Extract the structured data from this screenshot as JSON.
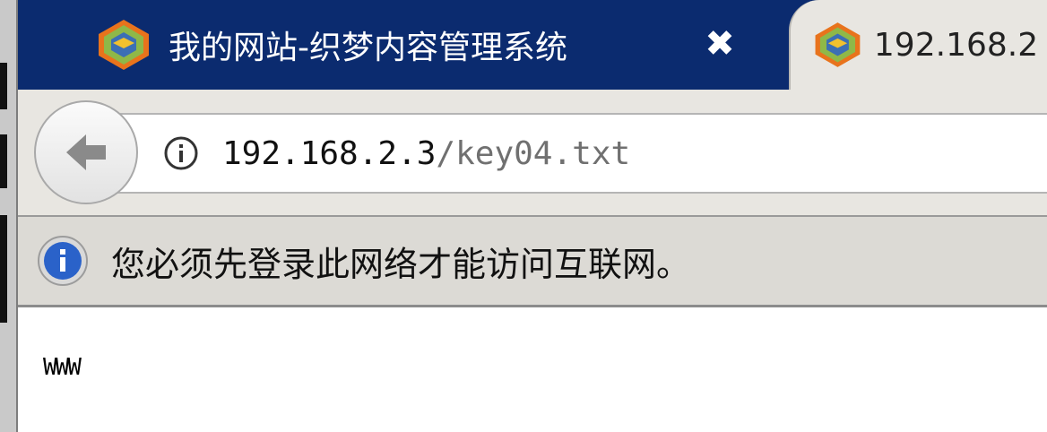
{
  "tabs": [
    {
      "title": "我的网站-织梦内容管理系统",
      "active": true,
      "icon": "dedecms-logo-icon"
    },
    {
      "title": "192.168.2",
      "active": false,
      "icon": "dedecms-logo-icon"
    }
  ],
  "tab_close_glyph": "✖",
  "nav": {
    "back_icon": "back-arrow-icon",
    "url_host": "192.168.2.3",
    "url_path": "/key04.txt",
    "identity_icon": "info-circle-icon"
  },
  "notification": {
    "icon": "info-icon",
    "text": "您必须先登录此网络才能访问互联网。"
  },
  "content": {
    "text": "WWW"
  },
  "colors": {
    "tab_strip": "#0b2b6f",
    "toolbar": "#e8e6e1",
    "notification_bg": "#dcdad5",
    "info_blue": "#2a62c9"
  }
}
